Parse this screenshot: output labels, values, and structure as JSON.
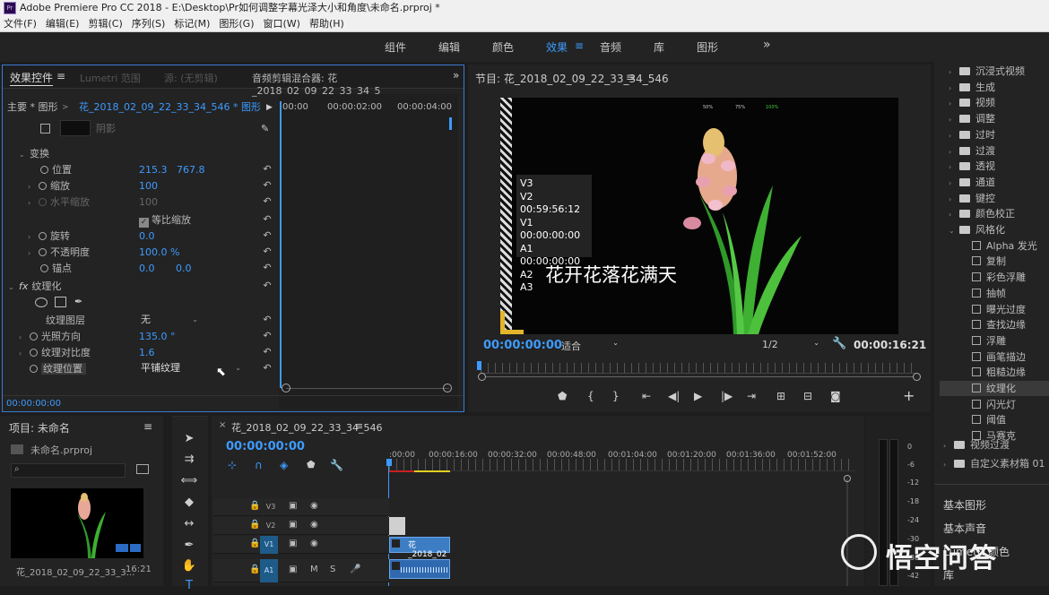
{
  "window": {
    "title": "Adobe Premiere Pro CC 2018 - E:\\Desktop\\Pr如何调整字幕光泽大小和角度\\未命名.prproj *",
    "logo": "Pr"
  },
  "menu": [
    "文件(F)",
    "编辑(E)",
    "剪辑(C)",
    "序列(S)",
    "标记(M)",
    "图形(G)",
    "窗口(W)",
    "帮助(H)"
  ],
  "workspaces": [
    {
      "label": "组件",
      "active": false
    },
    {
      "label": "编辑",
      "active": false
    },
    {
      "label": "颜色",
      "active": false
    },
    {
      "label": "效果",
      "active": true
    },
    {
      "label": "音频",
      "active": false
    },
    {
      "label": "库",
      "active": false
    },
    {
      "label": "图形",
      "active": false
    }
  ],
  "workspace_more": "»",
  "effect_controls": {
    "tab_active": "效果控件",
    "tab_menu": "≡",
    "tab2": "Lumetri 范围",
    "tab3": "源: (无剪辑)",
    "tab4": "音频剪辑混合器: 花_2018_02_09_22_33_34_5",
    "master_label": "主要 * 图形",
    "clip_label": "花_2018_02_09_22_33_34_546 * 图形",
    "timecodes": [
      "00:00",
      "00:00:02:00",
      "00:00:04:00"
    ],
    "shadow_label": "阴影",
    "transform": "变换",
    "position_label": "位置",
    "position_x": "215.3",
    "position_y": "767.8",
    "scale_label": "缩放",
    "scale_val": "100",
    "hscale_label": "水平缩放",
    "hscale_val": "100",
    "uniform_label": "等比缩放",
    "rotate_label": "旋转",
    "rotate_val": "0.0",
    "opacity_label": "不透明度",
    "opacity_val": "100.0 %",
    "anchor_label": "锚点",
    "anchor_x": "0.0",
    "anchor_y": "0.0",
    "fx_badge": "fx",
    "texturize": "纹理化",
    "layer_label": "纹理图层",
    "layer_val": "无",
    "light_label": "光照方向",
    "light_val": "135.0 °",
    "contrast_label": "纹理对比度",
    "contrast_val": "1.6",
    "placement_label": "纹理位置",
    "placement_val": "平铺纹理",
    "footer_time": "00:00:00:00"
  },
  "program": {
    "title": "节目: 花_2018_02_09_22_33_34_546",
    "menu": "≡",
    "overlay": [
      "V3",
      "V2 00:59:56:12",
      "V1 00:00:00:00",
      "A1 00:00:00:00",
      "A2",
      "A3"
    ],
    "caption": "花开花落花满天",
    "meters": [
      "50%",
      "75%",
      "100%"
    ],
    "timecode": "00:00:00:00",
    "fit": "适合",
    "resolution": "1/2",
    "duration": "00:00:16:21"
  },
  "effects_panel": {
    "items": [
      {
        "label": "沉浸式视频",
        "type": "folder",
        "open": false
      },
      {
        "label": "生成",
        "type": "folder",
        "open": false
      },
      {
        "label": "视频",
        "type": "folder",
        "open": false
      },
      {
        "label": "调整",
        "type": "folder",
        "open": false
      },
      {
        "label": "过时",
        "type": "folder",
        "open": false
      },
      {
        "label": "过渡",
        "type": "folder",
        "open": false
      },
      {
        "label": "透视",
        "type": "folder",
        "open": false
      },
      {
        "label": "通道",
        "type": "folder",
        "open": false
      },
      {
        "label": "键控",
        "type": "folder",
        "open": false
      },
      {
        "label": "颜色校正",
        "type": "folder",
        "open": false
      },
      {
        "label": "风格化",
        "type": "folder",
        "open": true
      },
      {
        "label": "Alpha 发光",
        "type": "fx"
      },
      {
        "label": "复制",
        "type": "fx"
      },
      {
        "label": "彩色浮雕",
        "type": "fx"
      },
      {
        "label": "抽帧",
        "type": "fx"
      },
      {
        "label": "曝光过度",
        "type": "fx"
      },
      {
        "label": "查找边缘",
        "type": "fx"
      },
      {
        "label": "浮雕",
        "type": "fx"
      },
      {
        "label": "画笔描边",
        "type": "fx"
      },
      {
        "label": "粗糙边缘",
        "type": "fx"
      },
      {
        "label": "纹理化",
        "type": "fx",
        "selected": true
      },
      {
        "label": "闪光灯",
        "type": "fx"
      },
      {
        "label": "阈值",
        "type": "fx"
      },
      {
        "label": "马赛克",
        "type": "fx"
      }
    ],
    "bottom_folders": [
      "视频过渡",
      "自定义素材箱 01"
    ],
    "stack": [
      "基本图形",
      "基本声音",
      "Lumetri 颜色",
      "库"
    ]
  },
  "project": {
    "title": "项目: 未命名",
    "menu": "≡",
    "file": "未命名.prproj",
    "search_placeholder": "",
    "clip_name": "花_2018_02_09_22_33_3...",
    "clip_dur": "16:21"
  },
  "timeline": {
    "tab": "花_2018_02_09_22_33_34_546",
    "menu": "≡",
    "close": "×",
    "timecode": "00:00:00:00",
    "ruler": [
      ":00:00",
      "00:00:16:00",
      "00:00:32:00",
      "00:00:48:00",
      "00:01:04:00",
      "00:01:20:00",
      "00:01:36:00",
      "00:01:52:00"
    ],
    "tracks": [
      {
        "name": "V3",
        "on": false
      },
      {
        "name": "V2",
        "on": false
      },
      {
        "name": "V1",
        "on": true
      },
      {
        "name": "A1",
        "on": true
      }
    ],
    "clip_label": "花_2018_02",
    "meter_labels": [
      "0",
      "-6",
      "-12",
      "-18",
      "-24",
      "-30",
      "-36",
      "-42"
    ]
  },
  "watermark": "悟空问答",
  "colors": {
    "accent": "#3d9bff",
    "bg": "#232323"
  }
}
